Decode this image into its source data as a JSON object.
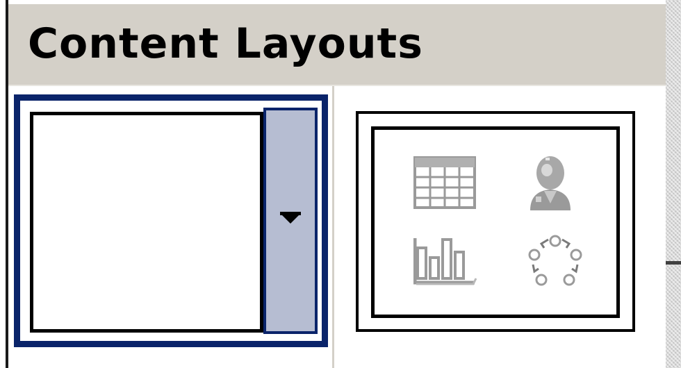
{
  "panel": {
    "title": "Content Layouts"
  },
  "layouts": [
    {
      "id": "blank",
      "selected": true,
      "has_dropdown": true
    },
    {
      "id": "content",
      "selected": false,
      "icons": [
        "insert-table-icon",
        "insert-clip-art-icon",
        "insert-chart-icon",
        "insert-diagram-icon"
      ]
    }
  ],
  "colors": {
    "header_bg": "#d4d0c8",
    "selection_border": "#0a246a",
    "dropdown_fill": "#b6bdd2",
    "icon_gray": "#9a9a9a"
  }
}
